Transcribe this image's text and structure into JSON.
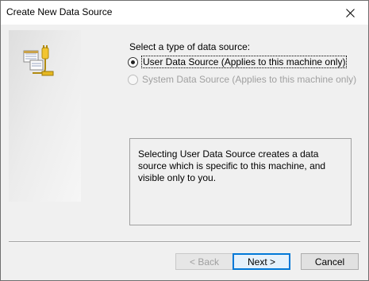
{
  "window": {
    "title": "Create New Data Source",
    "close_symbol": "✕"
  },
  "content": {
    "prompt": "Select a type of data source:",
    "options": [
      {
        "label": "User Data Source (Applies to this machine only)",
        "selected": true,
        "enabled": true
      },
      {
        "label": "System Data Source (Applies to this machine only)",
        "selected": false,
        "enabled": false
      }
    ],
    "description": "Selecting User Data Source creates a data source which is specific to this machine, and visible only to you."
  },
  "buttons": {
    "back": "< Back",
    "next": "Next >",
    "cancel": "Cancel"
  },
  "colors": {
    "accent": "#0078d7",
    "dialog_bg": "#f0f0f0",
    "disabled_text": "#a0a0a0"
  },
  "icons": {
    "side_panel": "data-source-wizard-icon",
    "close": "close-icon"
  }
}
